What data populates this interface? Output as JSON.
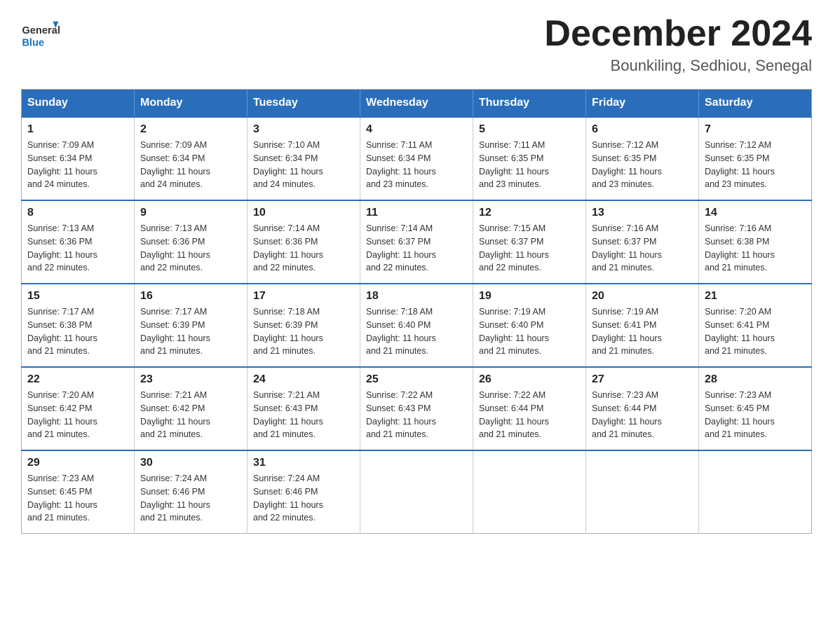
{
  "header": {
    "logo_general": "General",
    "logo_blue": "Blue",
    "month_title": "December 2024",
    "location": "Bounkiling, Sedhiou, Senegal"
  },
  "days_of_week": [
    "Sunday",
    "Monday",
    "Tuesday",
    "Wednesday",
    "Thursday",
    "Friday",
    "Saturday"
  ],
  "weeks": [
    [
      {
        "day": "1",
        "sunrise": "7:09 AM",
        "sunset": "6:34 PM",
        "daylight": "11 hours and 24 minutes."
      },
      {
        "day": "2",
        "sunrise": "7:09 AM",
        "sunset": "6:34 PM",
        "daylight": "11 hours and 24 minutes."
      },
      {
        "day": "3",
        "sunrise": "7:10 AM",
        "sunset": "6:34 PM",
        "daylight": "11 hours and 24 minutes."
      },
      {
        "day": "4",
        "sunrise": "7:11 AM",
        "sunset": "6:34 PM",
        "daylight": "11 hours and 23 minutes."
      },
      {
        "day": "5",
        "sunrise": "7:11 AM",
        "sunset": "6:35 PM",
        "daylight": "11 hours and 23 minutes."
      },
      {
        "day": "6",
        "sunrise": "7:12 AM",
        "sunset": "6:35 PM",
        "daylight": "11 hours and 23 minutes."
      },
      {
        "day": "7",
        "sunrise": "7:12 AM",
        "sunset": "6:35 PM",
        "daylight": "11 hours and 23 minutes."
      }
    ],
    [
      {
        "day": "8",
        "sunrise": "7:13 AM",
        "sunset": "6:36 PM",
        "daylight": "11 hours and 22 minutes."
      },
      {
        "day": "9",
        "sunrise": "7:13 AM",
        "sunset": "6:36 PM",
        "daylight": "11 hours and 22 minutes."
      },
      {
        "day": "10",
        "sunrise": "7:14 AM",
        "sunset": "6:36 PM",
        "daylight": "11 hours and 22 minutes."
      },
      {
        "day": "11",
        "sunrise": "7:14 AM",
        "sunset": "6:37 PM",
        "daylight": "11 hours and 22 minutes."
      },
      {
        "day": "12",
        "sunrise": "7:15 AM",
        "sunset": "6:37 PM",
        "daylight": "11 hours and 22 minutes."
      },
      {
        "day": "13",
        "sunrise": "7:16 AM",
        "sunset": "6:37 PM",
        "daylight": "11 hours and 21 minutes."
      },
      {
        "day": "14",
        "sunrise": "7:16 AM",
        "sunset": "6:38 PM",
        "daylight": "11 hours and 21 minutes."
      }
    ],
    [
      {
        "day": "15",
        "sunrise": "7:17 AM",
        "sunset": "6:38 PM",
        "daylight": "11 hours and 21 minutes."
      },
      {
        "day": "16",
        "sunrise": "7:17 AM",
        "sunset": "6:39 PM",
        "daylight": "11 hours and 21 minutes."
      },
      {
        "day": "17",
        "sunrise": "7:18 AM",
        "sunset": "6:39 PM",
        "daylight": "11 hours and 21 minutes."
      },
      {
        "day": "18",
        "sunrise": "7:18 AM",
        "sunset": "6:40 PM",
        "daylight": "11 hours and 21 minutes."
      },
      {
        "day": "19",
        "sunrise": "7:19 AM",
        "sunset": "6:40 PM",
        "daylight": "11 hours and 21 minutes."
      },
      {
        "day": "20",
        "sunrise": "7:19 AM",
        "sunset": "6:41 PM",
        "daylight": "11 hours and 21 minutes."
      },
      {
        "day": "21",
        "sunrise": "7:20 AM",
        "sunset": "6:41 PM",
        "daylight": "11 hours and 21 minutes."
      }
    ],
    [
      {
        "day": "22",
        "sunrise": "7:20 AM",
        "sunset": "6:42 PM",
        "daylight": "11 hours and 21 minutes."
      },
      {
        "day": "23",
        "sunrise": "7:21 AM",
        "sunset": "6:42 PM",
        "daylight": "11 hours and 21 minutes."
      },
      {
        "day": "24",
        "sunrise": "7:21 AM",
        "sunset": "6:43 PM",
        "daylight": "11 hours and 21 minutes."
      },
      {
        "day": "25",
        "sunrise": "7:22 AM",
        "sunset": "6:43 PM",
        "daylight": "11 hours and 21 minutes."
      },
      {
        "day": "26",
        "sunrise": "7:22 AM",
        "sunset": "6:44 PM",
        "daylight": "11 hours and 21 minutes."
      },
      {
        "day": "27",
        "sunrise": "7:23 AM",
        "sunset": "6:44 PM",
        "daylight": "11 hours and 21 minutes."
      },
      {
        "day": "28",
        "sunrise": "7:23 AM",
        "sunset": "6:45 PM",
        "daylight": "11 hours and 21 minutes."
      }
    ],
    [
      {
        "day": "29",
        "sunrise": "7:23 AM",
        "sunset": "6:45 PM",
        "daylight": "11 hours and 21 minutes."
      },
      {
        "day": "30",
        "sunrise": "7:24 AM",
        "sunset": "6:46 PM",
        "daylight": "11 hours and 21 minutes."
      },
      {
        "day": "31",
        "sunrise": "7:24 AM",
        "sunset": "6:46 PM",
        "daylight": "11 hours and 22 minutes."
      },
      null,
      null,
      null,
      null
    ]
  ],
  "labels": {
    "sunrise": "Sunrise:",
    "sunset": "Sunset:",
    "daylight": "Daylight:"
  }
}
